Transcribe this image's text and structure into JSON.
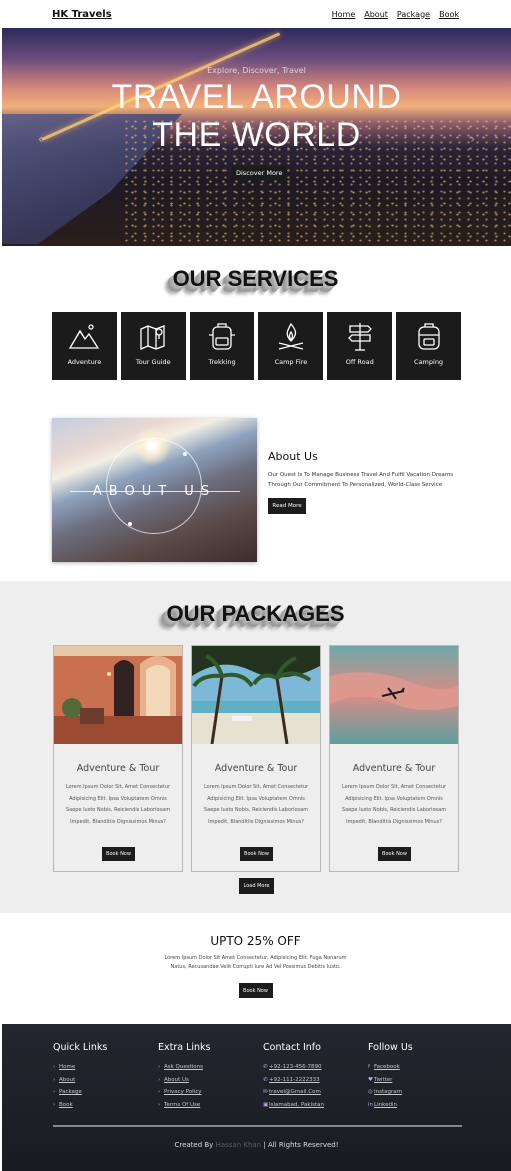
{
  "header": {
    "brand": "HK Travels",
    "nav": [
      "Home",
      "About",
      "Package",
      "Book"
    ]
  },
  "hero": {
    "tagline": "Explore, Discover, Travel",
    "title_line1": "TRAVEL AROUND",
    "title_line2": "THE WORLD",
    "cta": "Discover More",
    "prev_arrow": "‹",
    "next_arrow": "›"
  },
  "services": {
    "title": "OUR SERVICES",
    "items": [
      {
        "label": "Adventure",
        "icon": "mountain-icon"
      },
      {
        "label": "Tour Guide",
        "icon": "map-icon"
      },
      {
        "label": "Trekking",
        "icon": "backpack-icon"
      },
      {
        "label": "Camp Fire",
        "icon": "campfire-icon"
      },
      {
        "label": "Off Road",
        "icon": "signpost-icon"
      },
      {
        "label": "Camping",
        "icon": "backpack-icon"
      }
    ]
  },
  "about": {
    "image_label": "ABOUT US",
    "heading": "About Us",
    "text": "Our Quest Is To Manage Business Travel And Fulfil Vacation Dreams Through Our Commitment To Personalized, World-Class Service",
    "button": "Read More"
  },
  "packages": {
    "title": "OUR PACKAGES",
    "cards": [
      {
        "title": "Adventure & Tour",
        "text": "Lorem Ipsum Dolor Sit, Amet Consectetur Adipisicing Elit. Ipsa Voluptatem Omnis Saepe Iusto Nobis, Reiciendis Laboriosam Impedit, Blanditiis Dignissimos Minus?",
        "button": "Book Now",
        "photo": "corridor"
      },
      {
        "title": "Adventure & Tour",
        "text": "Lorem Ipsum Dolor Sit, Amet Consectetur Adipisicing Elit. Ipsa Voluptatem Omnis Saepe Iusto Nobis, Reiciendis Laboriosam Impedit, Blanditiis Dignissimos Minus?",
        "button": "Book Now",
        "photo": "beach"
      },
      {
        "title": "Adventure & Tour",
        "text": "Lorem Ipsum Dolor Sit, Amet Consectetur Adipisicing Elit. Ipsa Voluptatem Omnis Saepe Iusto Nobis, Reiciendis Laboriosam Impedit, Blanditiis Dignissimos Minus?",
        "button": "Book Now",
        "photo": "sky"
      }
    ],
    "load_more": "Load More"
  },
  "offer": {
    "title": "UPTO 25% OFF",
    "text": "Lorem Ipsum Dolor Sit Amet Consectetur, Adipisicing Elit. Fuga Nonarum Natus, Recusandae Velit Corrupti Iure Ad Vel Possimus Debitis Iusto.",
    "button": "Book Now"
  },
  "footer": {
    "quick_links": {
      "title": "Quick Links",
      "items": [
        "Home",
        "About",
        "Package",
        "Book"
      ]
    },
    "extra_links": {
      "title": "Extra Links",
      "items": [
        "Ask Questions",
        "About Us",
        "Privacy Policy",
        "Terms Of Use"
      ]
    },
    "contact": {
      "title": "Contact Info",
      "items": [
        "+92-123-456-7890",
        "+92-111-2222333",
        "travel@Gmail.Com",
        "Islamabad, Pakistan"
      ]
    },
    "follow": {
      "title": "Follow Us",
      "items": [
        "Facebook",
        "Twitter",
        "Instagram",
        "Linkedin"
      ]
    },
    "credit_prefix": "Created By",
    "credit_name": "Hassan Khan",
    "credit_suffix": "| All Rights Reserved!"
  },
  "colors": {
    "dark": "#1b1b1b",
    "section_bg": "#eeeeee",
    "footer_bg": "#23262e",
    "icon_accent": "#c6a3ea"
  }
}
